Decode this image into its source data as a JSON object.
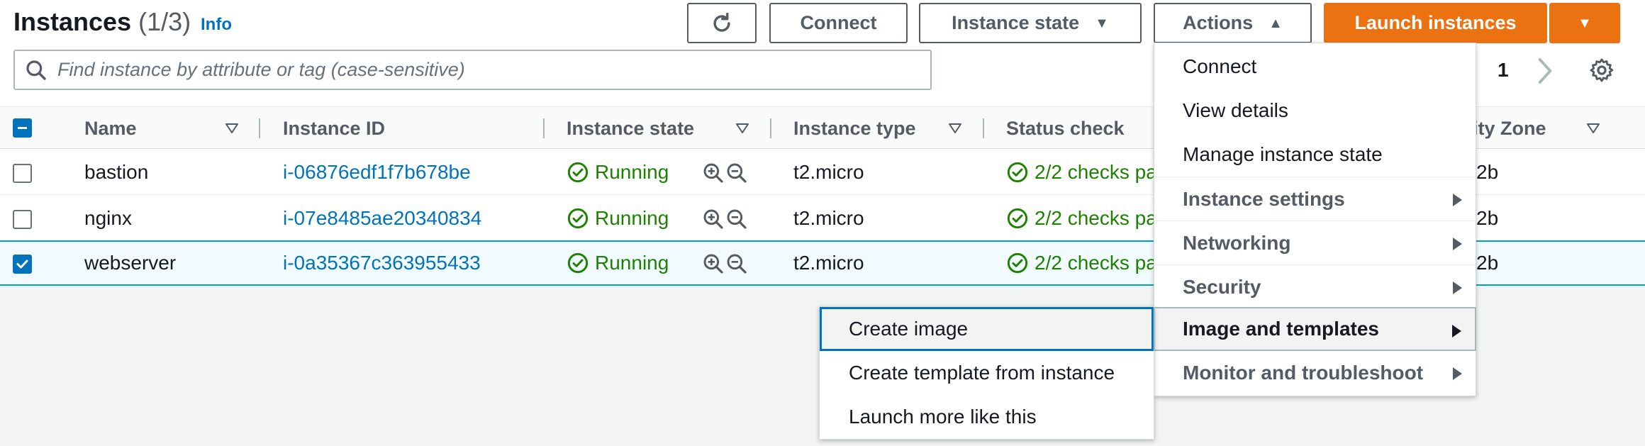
{
  "header": {
    "title": "Instances",
    "count": "(1/3)",
    "info": "Info"
  },
  "toolbar": {
    "connect": "Connect",
    "instance_state": "Instance state",
    "actions": "Actions",
    "launch": "Launch instances"
  },
  "search": {
    "placeholder": "Find instance by attribute or tag (case-sensitive)",
    "value": ""
  },
  "pagination": {
    "page": "1"
  },
  "table": {
    "columns": [
      "Name",
      "Instance ID",
      "Instance state",
      "Instance type",
      "Status check",
      "ility Zone"
    ],
    "rows": [
      {
        "name": "bastion",
        "id": "i-06876edf1f7b678be",
        "state": "Running",
        "type": "t2.micro",
        "status": "2/2 checks pa",
        "zone": "2b",
        "selected": false
      },
      {
        "name": "nginx",
        "id": "i-07e8485ae20340834",
        "state": "Running",
        "type": "t2.micro",
        "status": "2/2 checks pa",
        "zone": "2b",
        "selected": false
      },
      {
        "name": "webserver",
        "id": "i-0a35367c363955433",
        "state": "Running",
        "type": "t2.micro",
        "status": "2/2 checks pa",
        "zone": "2b",
        "selected": true
      }
    ]
  },
  "actions_menu": {
    "items": [
      "Connect",
      "View details",
      "Manage instance state"
    ],
    "groups": [
      "Instance settings",
      "Networking",
      "Security",
      "Image and templates",
      "Monitor and troubleshoot"
    ]
  },
  "submenu": {
    "items": [
      "Create image",
      "Create template from instance",
      "Launch more like this"
    ]
  },
  "colors": {
    "accent": "#0073bb",
    "primary": "#ec7211",
    "success": "#1d8102"
  }
}
